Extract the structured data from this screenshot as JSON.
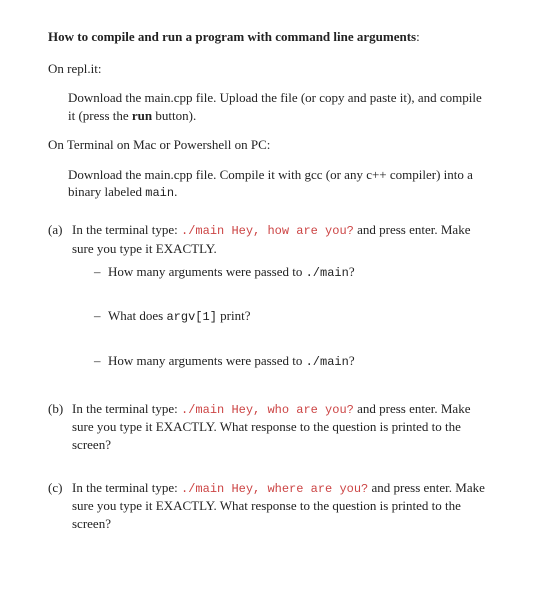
{
  "heading_bold": "How to compile and run a program with command line arguments",
  "heading_tail": ":",
  "p_replit_intro": "On repl.it:",
  "p_replit_body1": "Download the main.cpp file. Upload the file (or copy and paste it), and compile it (press the ",
  "p_replit_run": "run",
  "p_replit_body2": " button).",
  "p_term_intro": "On Terminal on Mac or Powershell on PC:",
  "p_term_body1": "Download the main.cpp file. Compile it with gcc (or any c++ compiler) into a binary labeled ",
  "p_term_main": "main",
  "p_term_body2": ".",
  "a_label": "(a)",
  "a_t1": "In the terminal type: ",
  "a_cmd": "./main Hey, how are you?",
  "a_t2": " and press enter. Make sure you type it EXACTLY.",
  "a_d1_t1": "How many arguments were passed to ",
  "a_d1_cmd": "./main",
  "a_d1_t2": "?",
  "a_d2_t1": "What does ",
  "a_d2_cmd": "argv[1]",
  "a_d2_t2": " print?",
  "a_d3_t1": "How many arguments were passed to ",
  "a_d3_cmd": "./main",
  "a_d3_t2": "?",
  "b_label": "(b)",
  "b_t1": "In the terminal type: ",
  "b_cmd": "./main Hey, who are you?",
  "b_t2": " and press enter. Make sure you type it EXACTLY. What response to the question is printed to the screen?",
  "c_label": "(c)",
  "c_t1": "In the terminal type: ",
  "c_cmd": "./main Hey, where are you?",
  "c_t2": " and press enter. Make sure you type it EXACTLY. What response to the question is printed to the screen?",
  "dash": "–"
}
